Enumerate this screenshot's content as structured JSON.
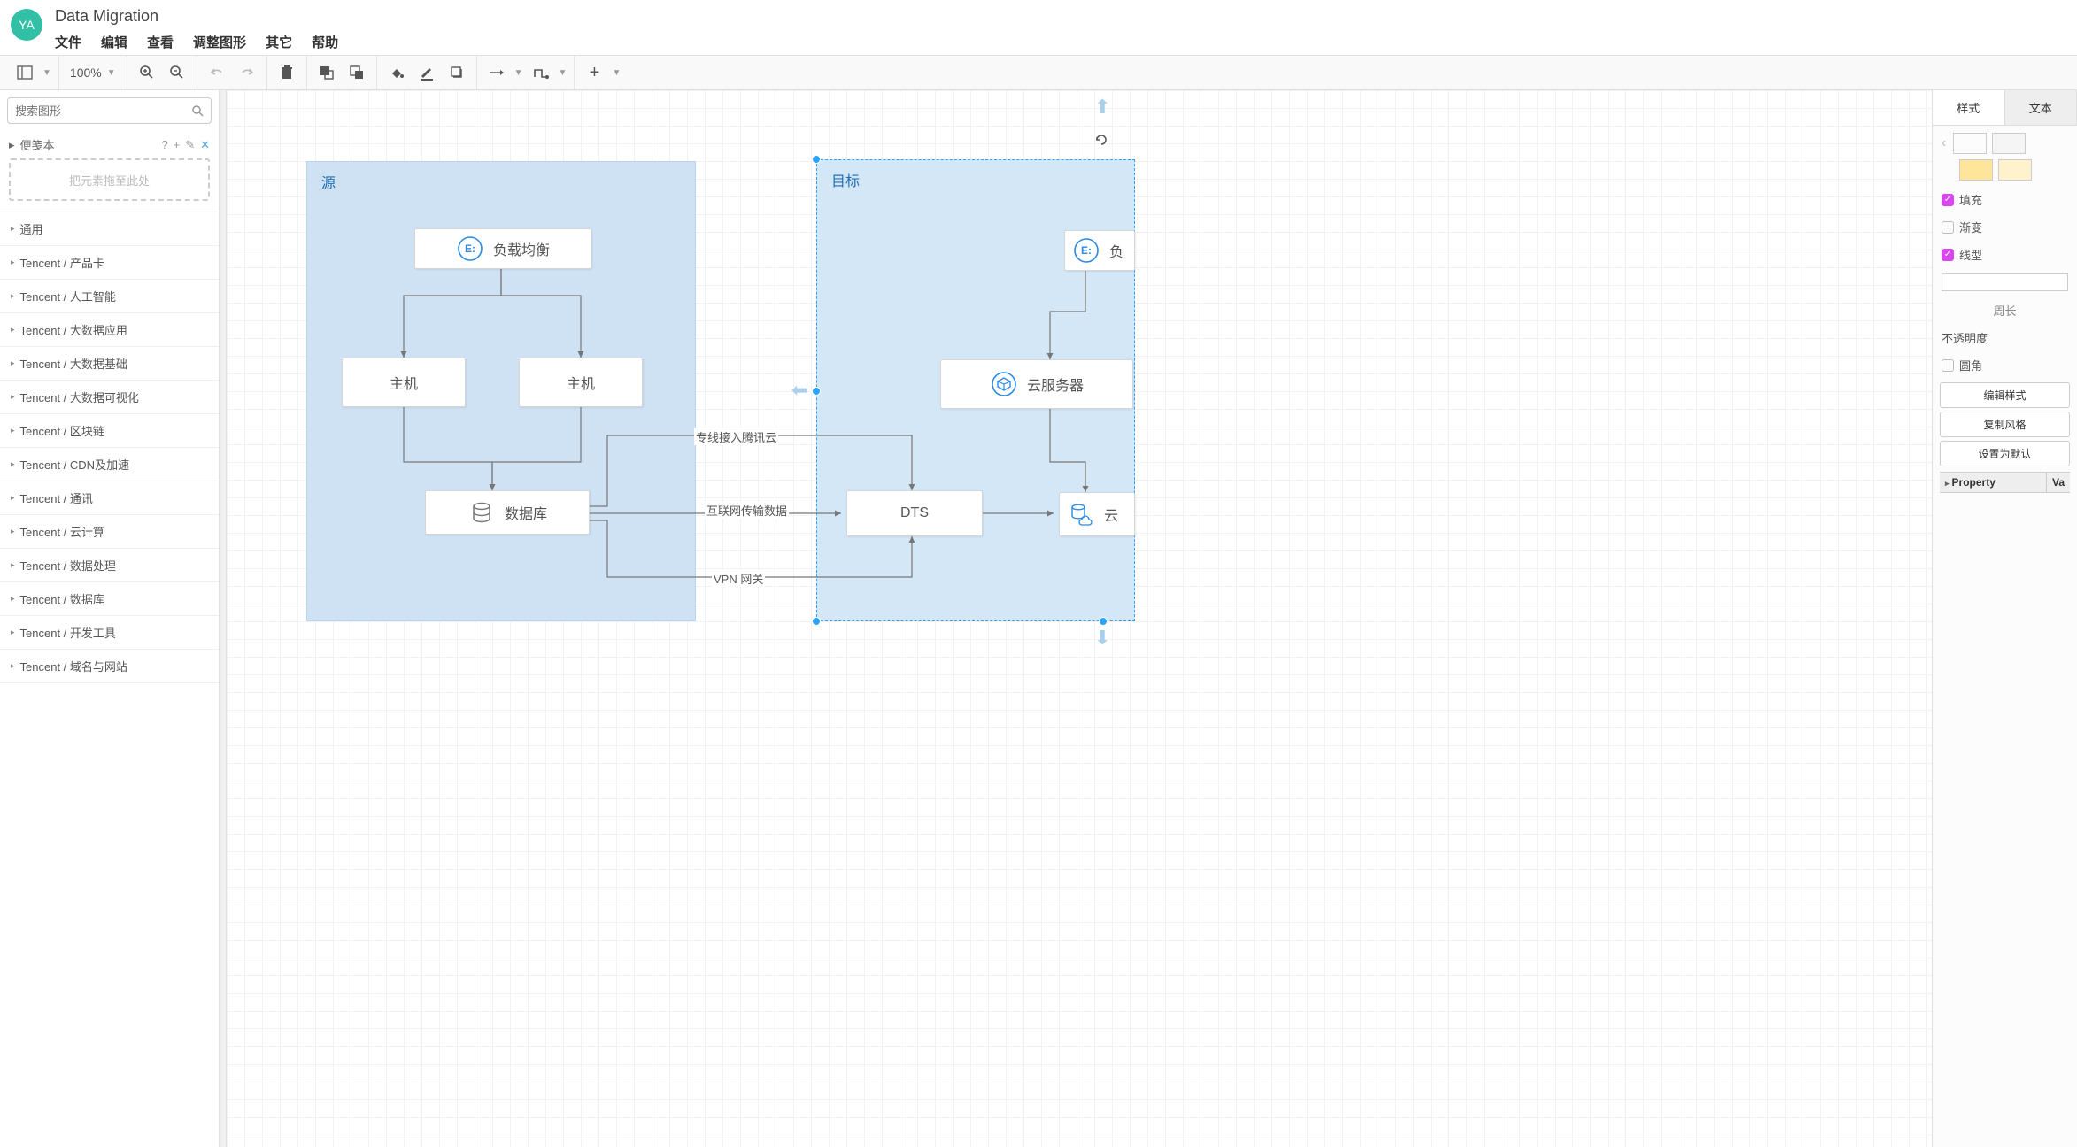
{
  "app": {
    "logo_text": "YA",
    "title": "Data Migration"
  },
  "menu": {
    "file": "文件",
    "edit": "编辑",
    "view": "查看",
    "arrange": "调整图形",
    "other": "其它",
    "help": "帮助"
  },
  "toolbar": {
    "zoom_value": "100%"
  },
  "sidebar": {
    "search_placeholder": "搜索图形",
    "scratchpad_label": "便笺本",
    "scratchpad_help": "?",
    "scratchpad_drop": "把元素拖至此处",
    "categories": [
      "通用",
      "Tencent / 产品卡",
      "Tencent / 人工智能",
      "Tencent / 大数据应用",
      "Tencent / 大数据基础",
      "Tencent / 大数据可视化",
      "Tencent / 区块链",
      "Tencent / CDN及加速",
      "Tencent / 通讯",
      "Tencent / 云计算",
      "Tencent / 数据处理",
      "Tencent / 数据库",
      "Tencent / 开发工具",
      "Tencent / 域名与网站"
    ]
  },
  "diagram": {
    "region_source": "源",
    "region_target": "目标",
    "node_lb": "负载均衡",
    "node_host1": "主机",
    "node_host2": "主机",
    "node_db": "数据库",
    "node_cvm": "云服务器",
    "node_lb2": "负",
    "node_dts": "DTS",
    "node_cdb": "云",
    "edge_dedicated": "专线接入腾讯云",
    "edge_internet": "互联网传输数据",
    "edge_vpn": "VPN 网关"
  },
  "panel": {
    "tab_style": "样式",
    "tab_text": "文本",
    "fill": "填充",
    "gradient": "渐变",
    "line": "线型",
    "perimeter": "周长",
    "opacity": "不透明度",
    "rounded": "圆角",
    "edit_style": "编辑样式",
    "copy_style": "复制风格",
    "set_default": "设置为默认",
    "property": "Property",
    "value": "Va",
    "swatches_top": [
      "#ffffff",
      "#f5f5f5"
    ],
    "swatches_bottom": [
      "#ffe599",
      "#fff2cc"
    ]
  }
}
